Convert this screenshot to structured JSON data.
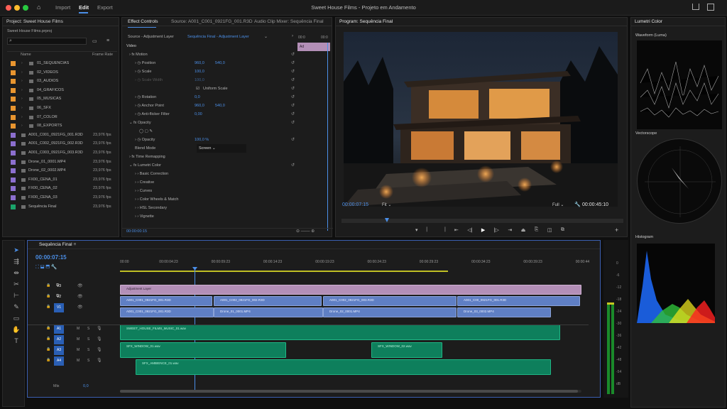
{
  "app": {
    "title": "Sweet House Films - Projeto em Andamento",
    "nav": [
      "Import",
      "Edit",
      "Export"
    ],
    "active_nav": "Edit"
  },
  "project": {
    "panel_title": "Project: Sweet House Films",
    "file": "Sweet House Films.prproj",
    "col_name": "Name",
    "col_rate": "Frame Rate",
    "folders": [
      {
        "name": "01_SEQUENCIAS",
        "color": "#e8952f"
      },
      {
        "name": "02_VIDEOS",
        "color": "#e8952f"
      },
      {
        "name": "03_AUDIOS",
        "color": "#e8952f"
      },
      {
        "name": "04_GRAFICOS",
        "color": "#e8952f"
      },
      {
        "name": "05_MUSICAS",
        "color": "#e8952f"
      },
      {
        "name": "06_SFX",
        "color": "#e8952f"
      },
      {
        "name": "07_COLOR",
        "color": "#e8952f"
      },
      {
        "name": "08_EXPORTS",
        "color": "#e8952f"
      }
    ],
    "items": [
      {
        "name": "A001_C001_0921FG_001.R3D",
        "rate": "23,976 fps",
        "color": "#8c6fcf"
      },
      {
        "name": "A001_C002_0921FG_002.R3D",
        "rate": "23,976 fps",
        "color": "#8c6fcf"
      },
      {
        "name": "A001_C003_0921FG_003.R3D",
        "rate": "23,976 fps",
        "color": "#8c6fcf"
      },
      {
        "name": "Drone_01_0001.MP4",
        "rate": "23,976 fps",
        "color": "#8c6fcf"
      },
      {
        "name": "Drone_02_0002.MP4",
        "rate": "23,976 fps",
        "color": "#8c6fcf"
      },
      {
        "name": "FX00_CENA_01",
        "rate": "23,976 fps",
        "color": "#8c6fcf"
      },
      {
        "name": "FX00_CENA_02",
        "rate": "23,976 fps",
        "color": "#8c6fcf"
      },
      {
        "name": "FX00_CENA_03",
        "rate": "23,976 fps",
        "color": "#8c6fcf"
      },
      {
        "name": "Sequência Final",
        "rate": "23,976 fps",
        "color": "#1aa36a"
      }
    ]
  },
  "effects": {
    "tabs": [
      "Effect Controls",
      "Source: A001_C001_0921FG_001.R3D",
      "Audio Clip Mixer: Sequência Final"
    ],
    "source_label": "Source - Adjustment Layer",
    "seq_label": "Sequência Final - Adjustment Layer",
    "timecode_head": "00:0",
    "timecode_head2": "00:0",
    "video_label": "Video",
    "clip_label": "Ad",
    "motion": "Motion",
    "position": {
      "label": "Position",
      "x": "960,0",
      "y": "540,0"
    },
    "scale": {
      "label": "Scale",
      "value": "100,0"
    },
    "scale_width": {
      "label": "Scale Width",
      "value": "100,0"
    },
    "uniform_scale": "Uniform Scale",
    "rotation": {
      "label": "Rotation",
      "value": "0,0"
    },
    "anchor": {
      "label": "Anchor Point",
      "x": "960,0",
      "y": "540,0"
    },
    "antiflicker": {
      "label": "Anti-flicker Filter",
      "value": "0,00"
    },
    "opacity_group": "Opacity",
    "opacity": {
      "label": "Opacity",
      "value": "100,0 %"
    },
    "blend": {
      "label": "Blend Mode",
      "value": "Screen"
    },
    "time_remap": "Time Remapping",
    "lumetri": "Lumetri Color",
    "lumetri_items": [
      "Basic Correction",
      "Creative",
      "Curves",
      "Color Wheels & Match",
      "HSL Secondary",
      "Vignette"
    ],
    "bottom_tc": "00:00:00:15"
  },
  "program": {
    "title": "Program: Sequência Final",
    "timecode": "00:00:07:15",
    "fit": "Fit",
    "quality": "Full",
    "duration": "00:00:45:10"
  },
  "lumetri_scopes": {
    "title": "Lumetri Color",
    "waveform": "Waveform (Luma)",
    "vectorscope": "Vectorscope",
    "histogram": "Histogram"
  },
  "timeline": {
    "title": "Sequência Final",
    "timecode": "00:00:07:15",
    "ruler": [
      "00:00",
      "00:00:04:23",
      "00:00:09:23",
      "00:00:14:23",
      "00:00:19:23",
      "00:00:24:23",
      "00:00:29:23",
      "00:00:34:23",
      "00:00:39:23",
      "00:00:44"
    ],
    "video_tracks": [
      "V3",
      "V2",
      "V1"
    ],
    "audio_tracks": [
      "A1",
      "A2",
      "A3",
      "A4"
    ],
    "mix_label": "Mix",
    "mix_value": "0,0",
    "clips": {
      "adjustment": "Adjustment Layer",
      "v2": [
        "A001_C001_0921FG_001.R3D",
        "A001_C002_0921FG_002.R3D",
        "A001_C002_0921FG_003.R3D",
        "A001_C00_0921FG_001.R3D"
      ],
      "v1": [
        "A001_C001_0921FG_001.R3D",
        "Drone_01_0001.MP4",
        "Drone_02_0001.MP4",
        "Drone_03_0002.MP4"
      ],
      "a1": "SWEET_HOUSE_FILMS_MUSIC_01.wav",
      "a2": [
        "SFX_WINDOW_01.wav",
        "SFX_WINDOW_02.wav"
      ],
      "a3": "SFX_AMBIENCE_01.wav"
    },
    "meter_labels": [
      "0",
      "-6",
      "-12",
      "-18",
      "-24",
      "-30",
      "-36",
      "-42",
      "-48",
      "-54",
      "dB"
    ]
  },
  "colors": {
    "accent": "#4b8fe8",
    "adjustment": "#b38fb7",
    "video_clip": "#5f7fc4",
    "audio_clip": "#0e7f5c"
  }
}
